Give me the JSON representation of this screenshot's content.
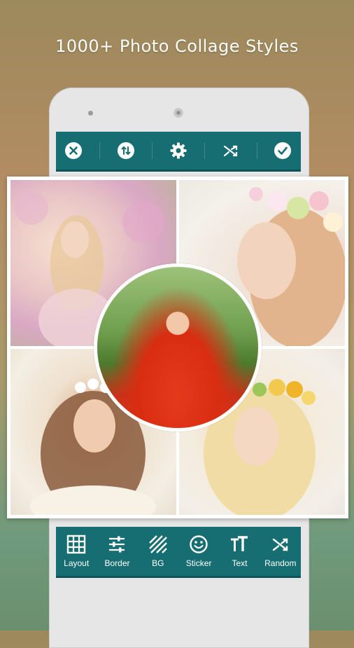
{
  "headline": "1000+ Photo Collage Styles",
  "colors": {
    "toolbar": "#176e72",
    "icon": "#ffffff"
  },
  "top_toolbar": {
    "buttons": [
      "close-icon",
      "swap-icon",
      "settings-icon",
      "shuffle-icon",
      "check-icon"
    ]
  },
  "bottom_toolbar": {
    "items": [
      {
        "label": "Layout",
        "icon": "grid-icon"
      },
      {
        "label": "Border",
        "icon": "sliders-icon"
      },
      {
        "label": "BG",
        "icon": "diagonal-stripes-icon"
      },
      {
        "label": "Sticker",
        "icon": "smiley-icon"
      },
      {
        "label": "Text",
        "icon": "text-size-icon"
      },
      {
        "label": "Random",
        "icon": "shuffle-icon"
      }
    ]
  }
}
